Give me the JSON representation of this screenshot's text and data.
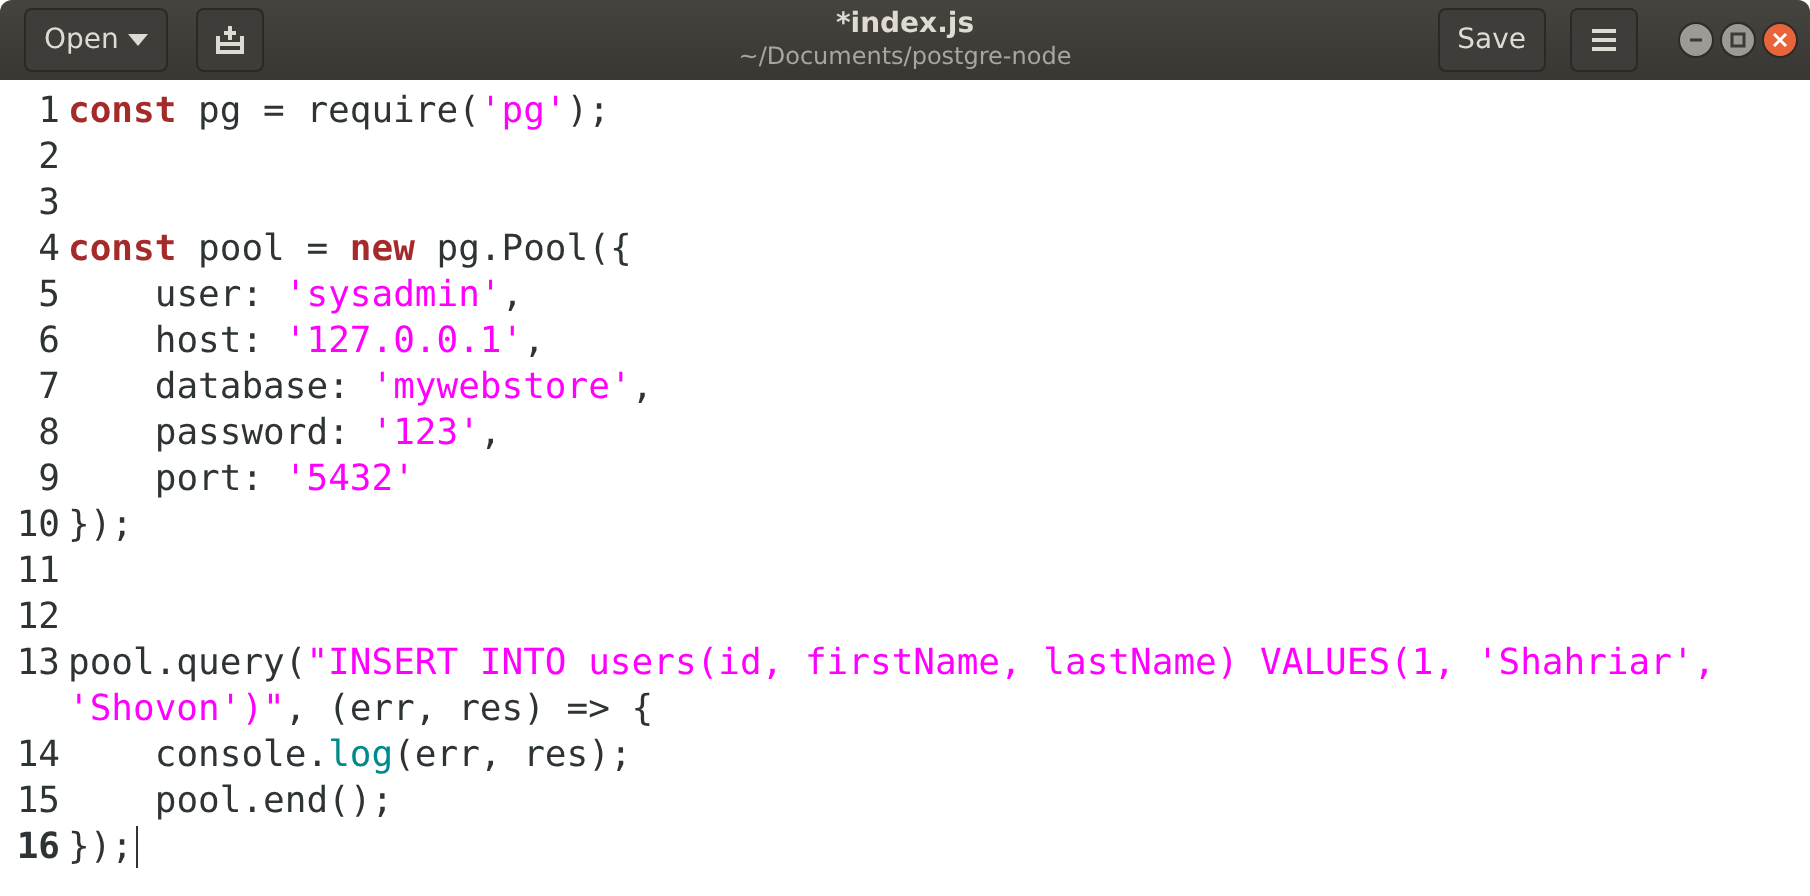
{
  "window": {
    "title": "*index.js",
    "subtitle": "~/Documents/postgre-node"
  },
  "header": {
    "open_label": "Open",
    "save_label": "Save"
  },
  "lines": [
    {
      "number": "1",
      "current": false,
      "tokens": [
        {
          "kind": "keyword",
          "text": "const"
        },
        {
          "kind": "plain",
          "text": " pg = require("
        },
        {
          "kind": "string",
          "text": "'pg'"
        },
        {
          "kind": "plain",
          "text": ");"
        }
      ]
    },
    {
      "number": "2",
      "current": false
    },
    {
      "number": "3",
      "current": false
    },
    {
      "number": "4",
      "current": false,
      "tokens": [
        {
          "kind": "keyword",
          "text": "const"
        },
        {
          "kind": "plain",
          "text": " pool = "
        },
        {
          "kind": "keyword",
          "text": "new"
        },
        {
          "kind": "plain",
          "text": " pg.Pool({"
        }
      ]
    },
    {
      "number": "5",
      "current": false,
      "tokens": [
        {
          "kind": "plain",
          "text": "    user: "
        },
        {
          "kind": "string",
          "text": "'sysadmin'"
        },
        {
          "kind": "plain",
          "text": ","
        }
      ]
    },
    {
      "number": "6",
      "current": false,
      "tokens": [
        {
          "kind": "plain",
          "text": "    host: "
        },
        {
          "kind": "string",
          "text": "'127.0.0.1'"
        },
        {
          "kind": "plain",
          "text": ","
        }
      ]
    },
    {
      "number": "7",
      "current": false,
      "tokens": [
        {
          "kind": "plain",
          "text": "    database: "
        },
        {
          "kind": "string",
          "text": "'mywebstore'"
        },
        {
          "kind": "plain",
          "text": ","
        }
      ]
    },
    {
      "number": "8",
      "current": false,
      "tokens": [
        {
          "kind": "plain",
          "text": "    password: "
        },
        {
          "kind": "string",
          "text": "'123'"
        },
        {
          "kind": "plain",
          "text": ","
        }
      ]
    },
    {
      "number": "9",
      "current": false,
      "tokens": [
        {
          "kind": "plain",
          "text": "    port: "
        },
        {
          "kind": "string",
          "text": "'5432'"
        }
      ]
    },
    {
      "number": "10",
      "current": false,
      "tokens": [
        {
          "kind": "plain",
          "text": "});"
        }
      ]
    },
    {
      "number": "11",
      "current": false
    },
    {
      "number": "12",
      "current": false
    },
    {
      "number": "13",
      "current": false,
      "tokens": [
        {
          "kind": "plain",
          "text": "pool.query("
        },
        {
          "kind": "string",
          "text": "\"INSERT INTO users(id, firstName, lastName) VALUES(1, 'Shahriar', 'Shovon')\""
        },
        {
          "kind": "plain",
          "text": ", (err, res) => {"
        }
      ]
    },
    {
      "number": "14",
      "current": false,
      "tokens": [
        {
          "kind": "plain",
          "text": "    console."
        },
        {
          "kind": "function",
          "text": "log"
        },
        {
          "kind": "plain",
          "text": "(err, res);"
        }
      ]
    },
    {
      "number": "15",
      "current": false,
      "tokens": [
        {
          "kind": "plain",
          "text": "    pool.end();"
        }
      ]
    },
    {
      "number": "16",
      "current": true,
      "tokens": [
        {
          "kind": "plain",
          "text": "});"
        }
      ]
    }
  ]
}
